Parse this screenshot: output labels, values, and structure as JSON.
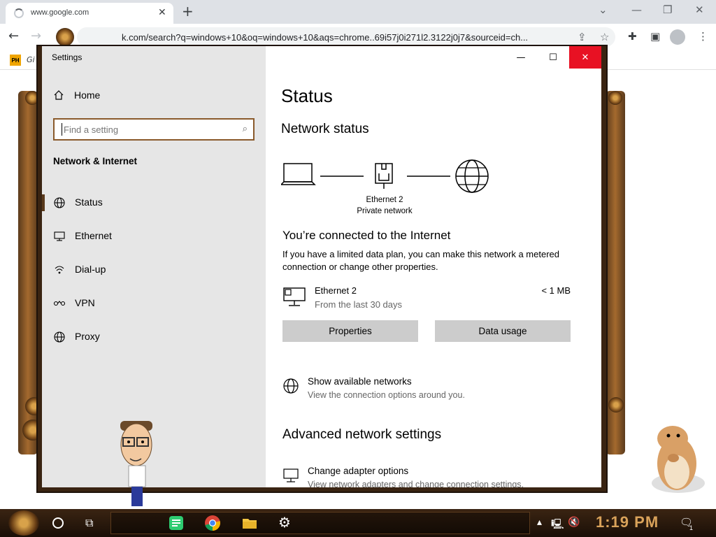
{
  "browser": {
    "tab_title": "www.google.com",
    "url": "k.com/search?q=windows+10&oq=windows+10&aqs=chrome..69i57j0i271l2.3122j0j7&sourceid=ch...",
    "bookmark_badge": "PH",
    "bookmark_label": "Gi"
  },
  "settings": {
    "window_title": "Settings",
    "home_label": "Home",
    "search_placeholder": "Find a setting",
    "section_title": "Network & Internet",
    "nav_items": [
      {
        "label": "Status",
        "icon": "globe-icon"
      },
      {
        "label": "Ethernet",
        "icon": "ethernet-icon"
      },
      {
        "label": "Dial-up",
        "icon": "dialup-icon"
      },
      {
        "label": "VPN",
        "icon": "vpn-icon"
      },
      {
        "label": "Proxy",
        "icon": "globe-icon"
      }
    ],
    "page_title": "Status",
    "network_status_heading": "Network status",
    "diagram_caption_line1": "Ethernet 2",
    "diagram_caption_line2": "Private network",
    "connected_heading": "You’re connected to the Internet",
    "connected_desc": "If you have a limited data plan, you can make this network a metered connection or change other properties.",
    "ethernet_name": "Ethernet 2",
    "ethernet_period": "From the last 30 days",
    "ethernet_usage": "< 1 MB",
    "properties_button": "Properties",
    "data_usage_button": "Data usage",
    "show_networks_title": "Show available networks",
    "show_networks_desc": "View the connection options around you.",
    "advanced_heading": "Advanced network settings",
    "adapter_title": "Change adapter options",
    "adapter_desc": "View network adapters and change connection settings."
  },
  "taskbar": {
    "clock": "1:19 PM",
    "notification_count": "1"
  },
  "colors": {
    "accent": "#5a3a1c",
    "close_red": "#e81123",
    "sidebar_bg": "#e6e6e6",
    "button_bg": "#cccccc",
    "clock_color": "#d9a25a"
  }
}
